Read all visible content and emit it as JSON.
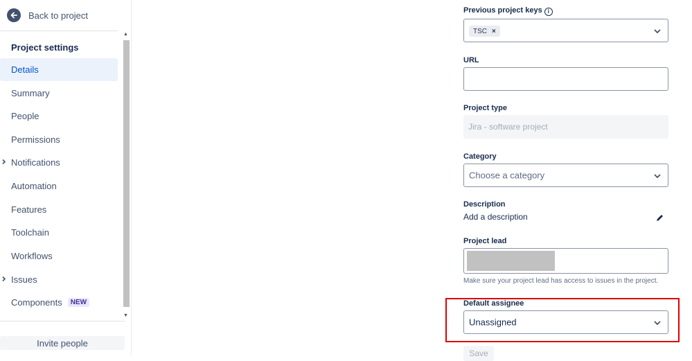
{
  "sidebar": {
    "back_label": "Back to project",
    "section_title": "Project settings",
    "items": [
      {
        "label": "Details",
        "active": true
      },
      {
        "label": "Summary"
      },
      {
        "label": "People"
      },
      {
        "label": "Permissions"
      },
      {
        "label": "Notifications",
        "expandable": true
      },
      {
        "label": "Automation"
      },
      {
        "label": "Features"
      },
      {
        "label": "Toolchain"
      },
      {
        "label": "Workflows"
      },
      {
        "label": "Issues",
        "expandable": true
      },
      {
        "label": "Components",
        "badge": "NEW"
      }
    ],
    "invite_label": "Invite people"
  },
  "form": {
    "previous_keys": {
      "label": "Previous project keys",
      "tags": [
        "TSC"
      ]
    },
    "url": {
      "label": "URL",
      "value": ""
    },
    "project_type": {
      "label": "Project type",
      "value": "Jira - software project"
    },
    "category": {
      "label": "Category",
      "placeholder": "Choose a category"
    },
    "description": {
      "label": "Description",
      "value": "Add a description"
    },
    "project_lead": {
      "label": "Project lead",
      "help": "Make sure your project lead has access to issues in the project."
    },
    "default_assignee": {
      "label": "Default assignee",
      "value": "Unassigned"
    },
    "save_label": "Save"
  },
  "colors": {
    "accent": "#0052cc",
    "highlight": "#e00000"
  }
}
